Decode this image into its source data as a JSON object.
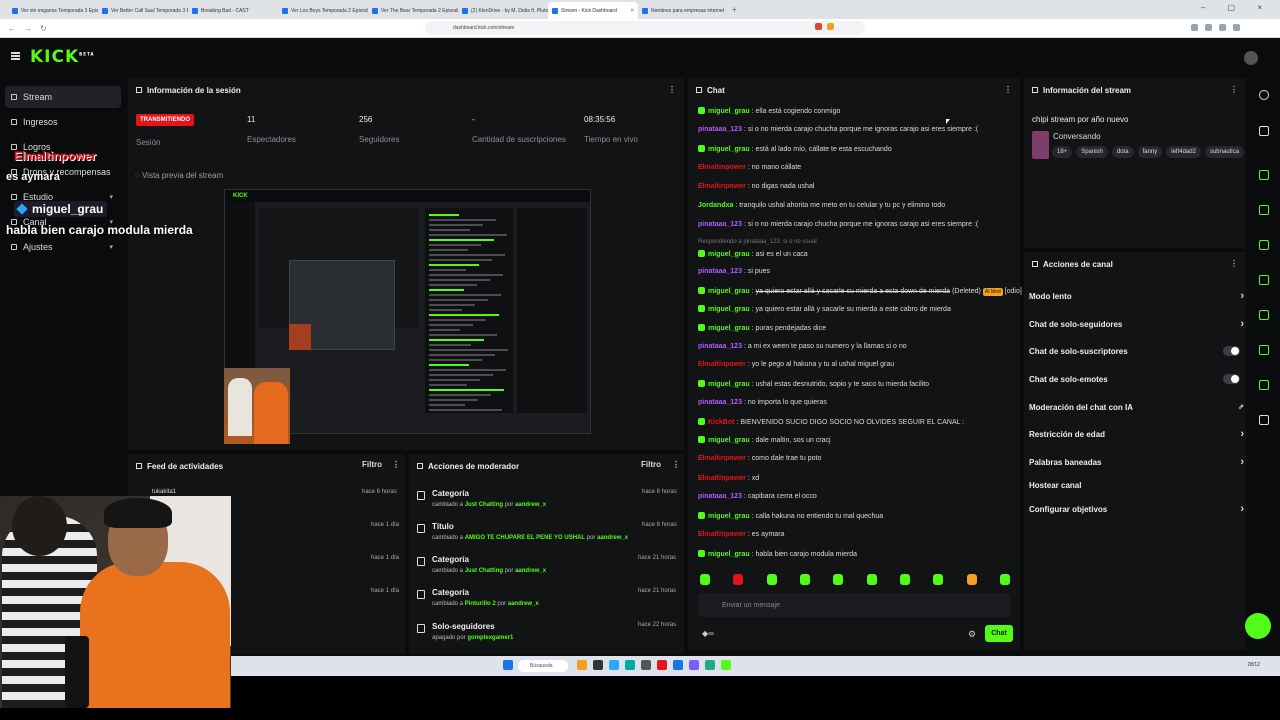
{
  "browser": {
    "tabs": [
      {
        "label": "Ver sin enganos Temporada 3 Episod"
      },
      {
        "label": "Ver Better Call Saul Temporada 3 Ep"
      },
      {
        "label": "Breaking Bad - CAST"
      },
      {
        "label": "Ver Los Boys Temporada 2 Episodio"
      },
      {
        "label": "Ver The Bear Temporada 2 Episodio"
      },
      {
        "label": "(2) KlenDrive - by M. Dobs ft. Pluto"
      },
      {
        "label": "Stream - Kick Dashboard"
      },
      {
        "label": "Nombres para empresas internet"
      }
    ],
    "url": "dashboard.kick.com/stream"
  },
  "app": {
    "logo": "KICK",
    "logo_sup": "BETA"
  },
  "sidebar": {
    "items": [
      {
        "label": "Stream"
      },
      {
        "label": "Ingresos"
      },
      {
        "label": "Logros"
      },
      {
        "label": "Drops y recompensas"
      },
      {
        "label": "Estudio"
      },
      {
        "label": "Canal"
      },
      {
        "label": "Ajustes"
      }
    ]
  },
  "session": {
    "title": "Información de la sesión",
    "live_badge": "TRANSMITIENDO",
    "live_label": "Sesión",
    "stats": [
      {
        "value": "11",
        "label": "Espectadores"
      },
      {
        "value": "256",
        "label": "Seguidores"
      },
      {
        "value": "-",
        "label": "Cantidad de suscripciones"
      },
      {
        "value": "08:35:56",
        "label": "Tiempo en vivo"
      }
    ],
    "preview_label": "Vista previa del stream"
  },
  "feed": {
    "title": "Feed de actividades",
    "filter": "Filtro",
    "rows": [
      {
        "name": "tukakita1",
        "time": "hace 6 horas"
      },
      {
        "name": "",
        "time": "hace 1 día"
      },
      {
        "name": "",
        "time": "hace 1 día"
      },
      {
        "name": "",
        "time": "hace 1 día"
      }
    ]
  },
  "modactions": {
    "title": "Acciones de moderador",
    "filter": "Filtro",
    "items": [
      {
        "title": "Categoría",
        "sub_pre": "cambiado a",
        "value": "Just Chatting",
        "by": "por",
        "user": "aandrew_x",
        "time": "hace 8 horas"
      },
      {
        "title": "Título",
        "sub_pre": "cambiado a",
        "value": "AMIGO TE CHUPARE EL PENE YO USHAL",
        "by": "por",
        "user": "aandrew_x",
        "time": "hace 8 horas"
      },
      {
        "title": "Categoría",
        "sub_pre": "cambiado a",
        "value": "Just Chatting",
        "by": "por",
        "user": "aandrew_x",
        "time": "hace 21 horas"
      },
      {
        "title": "Categoría",
        "sub_pre": "cambiado a",
        "value": "Pinturillo 2",
        "by": "por",
        "user": "aandrew_x",
        "time": "hace 21 horas"
      },
      {
        "title": "Solo-seguidores",
        "sub_pre": "apagado por",
        "value": "",
        "by": "",
        "user": "gomplexgamer1",
        "time": "hace 22 horas"
      }
    ]
  },
  "chat": {
    "title": "Chat",
    "messages": [
      {
        "user": "miguel_grau",
        "color": "#53fc18",
        "badge": true,
        "text": "ella está cogiendo conmigo"
      },
      {
        "user": "pinataaa_123",
        "color": "#b05cff",
        "badge": false,
        "text": "si o no mierda carajo chucha porque me ignoras carajo asi eres siempre :("
      },
      {
        "user": "miguel_grau",
        "color": "#53fc18",
        "badge": true,
        "text": "está al lado mío, cállate te esta escuchando"
      },
      {
        "user": "Elmaltinpower",
        "color": "#e3141a",
        "badge": false,
        "text": "no mano cállate"
      },
      {
        "user": "Elmaltinpower",
        "color": "#e3141a",
        "badge": false,
        "text": "no digas nada ushal"
      },
      {
        "user": "Jordandxa",
        "color": "#53fc18",
        "badge": false,
        "text": "tranquilo ushal ahorita me meto en tu celular y tu pc y elimino todo"
      },
      {
        "user": "pinataaa_123",
        "color": "#b05cff",
        "badge": false,
        "text": "si o no mierda carajo chucha porque me ignoras carajo asi eres siempre :("
      },
      {
        "user": "miguel_grau",
        "color": "#53fc18",
        "badge": true,
        "text": "asi es el un caca"
      },
      {
        "user": "pinataaa_123",
        "color": "#b05cff",
        "badge": false,
        "text": "si pues"
      },
      {
        "user": "miguel_grau",
        "color": "#53fc18",
        "badge": true,
        "text": "ya quiero estar allá y sacarle su mierda a esta down de mierda"
      },
      {
        "user": "miguel_grau",
        "color": "#53fc18",
        "badge": true,
        "text": "ya quiero estar allá y sacarle su mierda a este cabro de mierda"
      },
      {
        "user": "miguel_grau",
        "color": "#53fc18",
        "badge": true,
        "text": "puras pendejadas dice"
      },
      {
        "user": "pinataaa_123",
        "color": "#b05cff",
        "badge": false,
        "text": "a mi ex ween te paso su numero y la llamas si o no"
      },
      {
        "user": "Elmaltinpower",
        "color": "#e3141a",
        "badge": false,
        "text": "yo le pego al hakuna y tu al ushal miguel grau"
      },
      {
        "user": "miguel_grau",
        "color": "#53fc18",
        "badge": true,
        "text": "ushal estas desnutrido, sopio y te saco tu mierda facilito"
      },
      {
        "user": "pinataaa_123",
        "color": "#b05cff",
        "badge": false,
        "text": "no importa lo que quieras"
      },
      {
        "user": "KickBot",
        "color": "#e3141a",
        "badge": true,
        "text": "BIENVENIDO SUCIO DIGO SOCIO NO OLVIDES SEGUIR EL CANAL :"
      },
      {
        "user": "miguel_grau",
        "color": "#53fc18",
        "badge": true,
        "text": "dale maltin, sos un cracj"
      },
      {
        "user": "Elmaltinpower",
        "color": "#e3141a",
        "badge": false,
        "text": "como dale trae tu poto"
      },
      {
        "user": "Elmaltinpower",
        "color": "#e3141a",
        "badge": false,
        "text": "xd"
      },
      {
        "user": "pinataaa_123",
        "color": "#b05cff",
        "badge": false,
        "text": "capibara cerra el occo"
      },
      {
        "user": "miguel_grau",
        "color": "#53fc18",
        "badge": true,
        "text": "calla hakuna no entiendo tu mal quechua"
      },
      {
        "user": "Elmaltinpower",
        "color": "#e3141a",
        "badge": false,
        "text": "es aymara"
      },
      {
        "user": "miguel_grau",
        "color": "#53fc18",
        "badge": true,
        "text": "habla bien carajo modula mierda"
      }
    ],
    "reply_note": "Respondiendo a pinataaa_123: si o no usual",
    "deleted_tag": "(Deleted)",
    "mod_tag": "AI Mod",
    "odio_tag": "[odio]",
    "input_placeholder": "Enviar un mensaje",
    "send_label": "Chat",
    "accent": "#53fc18"
  },
  "streaminfo": {
    "title": "Información del stream",
    "stream_title": "chipi stream por año nuevo",
    "category": "Conversando",
    "tags": [
      "18+",
      "Spanish",
      "dota",
      "fanny",
      "left4dad2",
      "subnautica"
    ]
  },
  "channel": {
    "title": "Acciones de canal",
    "rows": [
      {
        "label": "Modo lento",
        "kind": "arrow"
      },
      {
        "label": "Chat de solo-seguidores",
        "kind": "arrow"
      },
      {
        "label": "Chat de solo-suscriptores",
        "kind": "toggle"
      },
      {
        "label": "Chat de solo-emotes",
        "kind": "toggle"
      },
      {
        "label": "Moderación del chat con IA",
        "kind": "link"
      },
      {
        "label": "Restricción de edad",
        "kind": "arrow"
      },
      {
        "label": "Palabras baneadas",
        "kind": "arrow"
      },
      {
        "label": "Hostear canal",
        "kind": "none"
      },
      {
        "label": "Configurar objetivos",
        "kind": "arrow"
      }
    ]
  },
  "taskbar": {
    "search": "Búsqueda",
    "clock": "28/12"
  },
  "overlay": {
    "line1": "Elmaltinpower",
    "line2": "es aymara",
    "line3": "miguel_grau",
    "line4": "habla bien carajo modula mierda"
  }
}
